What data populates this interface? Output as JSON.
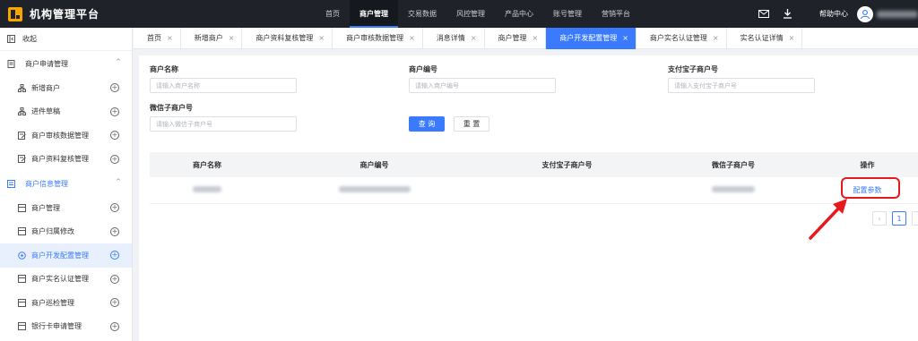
{
  "app": {
    "title": "机构管理平台"
  },
  "topnav": {
    "items": [
      {
        "label": "首页"
      },
      {
        "label": "商户管理"
      },
      {
        "label": "交易数据"
      },
      {
        "label": "风控管理"
      },
      {
        "label": "产品中心"
      },
      {
        "label": "账号管理"
      },
      {
        "label": "营销平台"
      }
    ],
    "active_index": 1,
    "help": "帮助中心",
    "icons": [
      "mail-icon",
      "download-icon",
      "user-avatar-icon"
    ]
  },
  "sidebar": {
    "collapse_label": "收起",
    "groups": [
      {
        "label": "商户申请管理",
        "icon": "document-icon",
        "active": false
      },
      {
        "label": "商户信息管理",
        "icon": "info-icon",
        "active": true
      }
    ],
    "items": [
      {
        "label": "新增商户",
        "icon": "org-icon"
      },
      {
        "label": "进件草稿",
        "icon": "org-icon"
      },
      {
        "label": "商户审核数据管理",
        "icon": "edit-doc-icon"
      },
      {
        "label": "商户资料复核管理",
        "icon": "edit-doc-icon"
      },
      {
        "label": "商户管理",
        "icon": "list-icon"
      },
      {
        "label": "商户归属修改",
        "icon": "list-icon"
      },
      {
        "label": "商户开发配置管理",
        "icon": "circle-icon"
      },
      {
        "label": "商户实名认证管理",
        "icon": "list-icon"
      },
      {
        "label": "商户巡检管理",
        "icon": "list-icon"
      },
      {
        "label": "银行卡申请管理",
        "icon": "list-icon"
      }
    ],
    "active_item": "商户开发配置管理"
  },
  "tabs": {
    "items": [
      {
        "label": "首页"
      },
      {
        "label": "新增商户"
      },
      {
        "label": "商户资料复核管理"
      },
      {
        "label": "商户审核数据管理"
      },
      {
        "label": "消息详情"
      },
      {
        "label": "商户管理"
      },
      {
        "label": "商户开发配置管理"
      },
      {
        "label": "商户实名认证管理"
      },
      {
        "label": "实名认证详情"
      }
    ],
    "active_index": 6
  },
  "filters": {
    "merchant_name": {
      "label": "商户名称",
      "placeholder": "请输入商户名称",
      "value": ""
    },
    "merchant_no": {
      "label": "商户编号",
      "placeholder": "请输入商户编号",
      "value": ""
    },
    "alipay_sub": {
      "label": "支付宝子商户号",
      "placeholder": "请输入支付宝子商户号",
      "value": ""
    },
    "wechat_sub": {
      "label": "微信子商户号",
      "placeholder": "请输入微信子商户号",
      "value": ""
    },
    "search_label": "查 询",
    "reset_label": "重 置"
  },
  "table": {
    "columns": [
      "商户名称",
      "商户编号",
      "支付宝子商户号",
      "微信子商户号",
      "操作"
    ],
    "rows": [
      {
        "action": "配置参数"
      }
    ]
  },
  "pagination": {
    "current_page": "1"
  },
  "colors": {
    "accent": "#3a7afe",
    "topbar": "#1f2329",
    "highlight": "#e8191d",
    "logo": "#f7a600"
  }
}
